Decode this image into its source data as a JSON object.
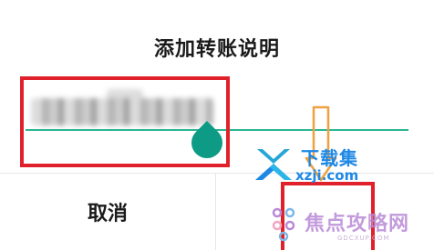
{
  "dialog": {
    "title": "添加转账说明",
    "input": {
      "value_obscured": true
    },
    "buttons": {
      "cancel": "取消"
    }
  },
  "watermarks": {
    "xzji": {
      "text": "下载集",
      "sub": "xzji.com"
    },
    "jiaodian": {
      "text": "焦点攻略网",
      "sub": "GDCXUP.COM"
    }
  },
  "colors": {
    "accent": "#2bb593",
    "handle": "#0d9b86",
    "annotation_red": "#e0202a",
    "annotation_orange": "#f0a040",
    "watermark_blue": "#1e88e5",
    "watermark_purple": "#b98ad6"
  }
}
